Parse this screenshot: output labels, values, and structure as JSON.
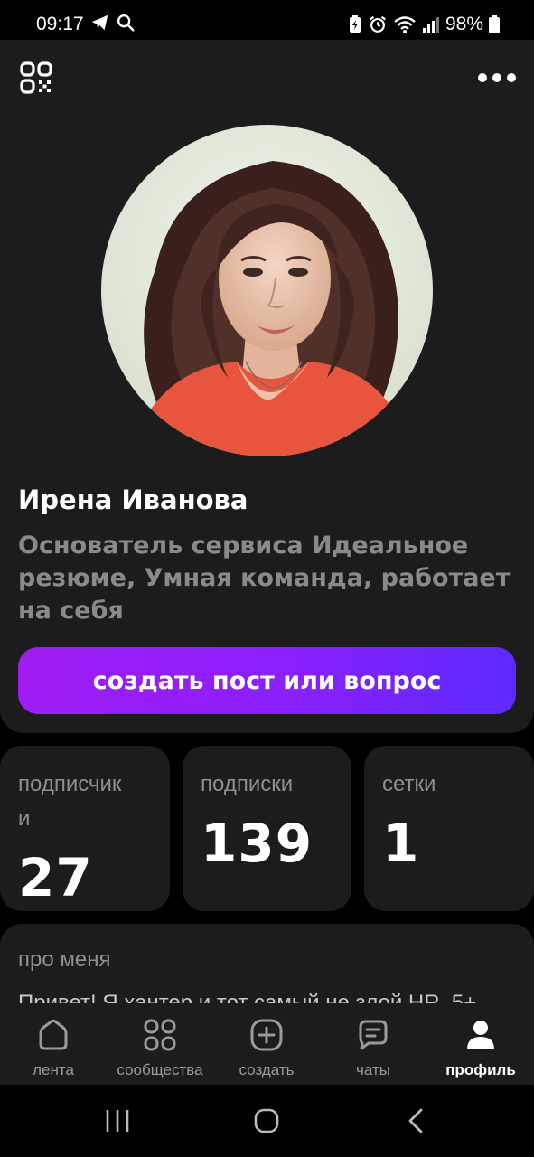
{
  "status": {
    "time": "09:17",
    "battery": "98%"
  },
  "profile": {
    "name": "Ирена Иванова",
    "bio": "Основатель сервиса Идеальное резюме, Умная команда, работает на себя",
    "cta": "создать пост или вопрос"
  },
  "stats": [
    {
      "label": "подписчик\nи",
      "value": "27"
    },
    {
      "label": "подписки",
      "value": "139"
    },
    {
      "label": "сетки",
      "value": "1"
    }
  ],
  "about": {
    "title": "про меня",
    "text": "Привет! Я хантер и тот самый не злой HR. 5+"
  },
  "nav": [
    {
      "label": "лента",
      "icon": "home-icon"
    },
    {
      "label": "сообщества",
      "icon": "communities-icon"
    },
    {
      "label": "создать",
      "icon": "create-icon"
    },
    {
      "label": "чаты",
      "icon": "chats-icon"
    },
    {
      "label": "профиль",
      "icon": "profile-icon",
      "active": true
    }
  ],
  "colors": {
    "background": "#000000",
    "card": "#1c1c1c",
    "accent_start": "#a01df2",
    "accent_end": "#5c2bff",
    "muted_text": "#8a8a8a"
  }
}
